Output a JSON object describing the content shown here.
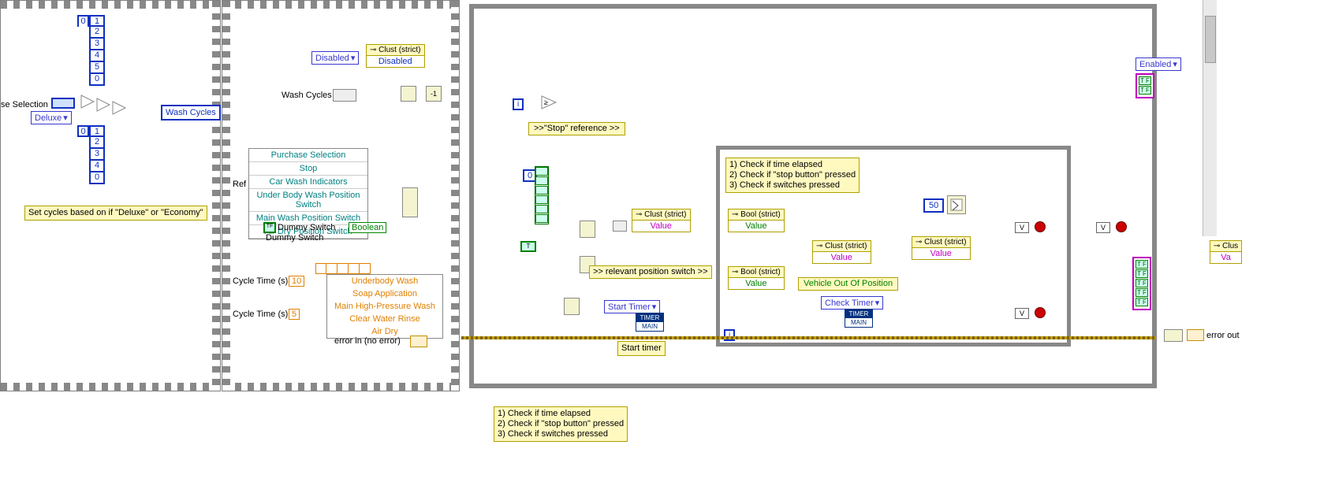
{
  "frame1": {
    "caption": "Set cycles based on if \"Deluxe\" or \"Economy\"",
    "selection_label": "se Selection",
    "deluxe": "Deluxe",
    "wash_cycles": "Wash Cycles",
    "idx_top": [
      "0",
      "1",
      "2",
      "3",
      "4",
      "5",
      "0"
    ],
    "idx_bot": [
      "0",
      "1",
      "2",
      "3",
      "4",
      "0"
    ]
  },
  "frame2": {
    "disabled": "Disabled",
    "disabled_prop": "⊸ Clust (strict)",
    "wash_cycles_lbl": "Wash Cycles",
    "ref_cluster": "Ref cluster",
    "cluster_items": [
      "Purchase Selection",
      "Stop",
      "Car Wash Indicators",
      "Under Body Wash Position Switch",
      "Main Wash Position Switch",
      "Air Dry Position Switch"
    ],
    "dummy_switch": "Dummy Switch",
    "dummy_switch2": "Dummy Switch",
    "boolean": "Boolean",
    "orange_items": [
      "Underbody Wash",
      "Soap Application",
      "Main High-Pressure Wash",
      "Clear Water Rinse",
      "Air Dry"
    ],
    "cycle_time_a": "Cycle Time (s)",
    "cycle_time_a_val": "10",
    "cycle_time_b": "Cycle Time (s)",
    "cycle_time_b_val": "5",
    "error_in": "error in (no error)"
  },
  "main": {
    "stop_ref": ">>\"Stop\" reference >>",
    "i": "i",
    "check_list": "1) Check if time elapsed\n2) Check if \"stop button\" pressed\n3) Check if switches pressed",
    "prop_clust": "⊸ Clust (strict)",
    "prop_bool": "⊸ Bool (strict)",
    "prop_value": "Value",
    "pos_switch": ">> relevant position switch >>",
    "start_timer": "Start Timer",
    "start_timer_cap": "Start timer",
    "check_timer": "Check Timer",
    "vehicle_oop": "Vehicle Out Of Position",
    "fifty": "50",
    "enabled": "Enabled",
    "error_out": "error out",
    "clust_partial": "⊸ Clus",
    "val_partial": "Va",
    "zero": "0"
  },
  "bottom_note": "1) Check if time elapsed\n2) Check if \"stop button\" pressed\n3) Check if switches pressed"
}
